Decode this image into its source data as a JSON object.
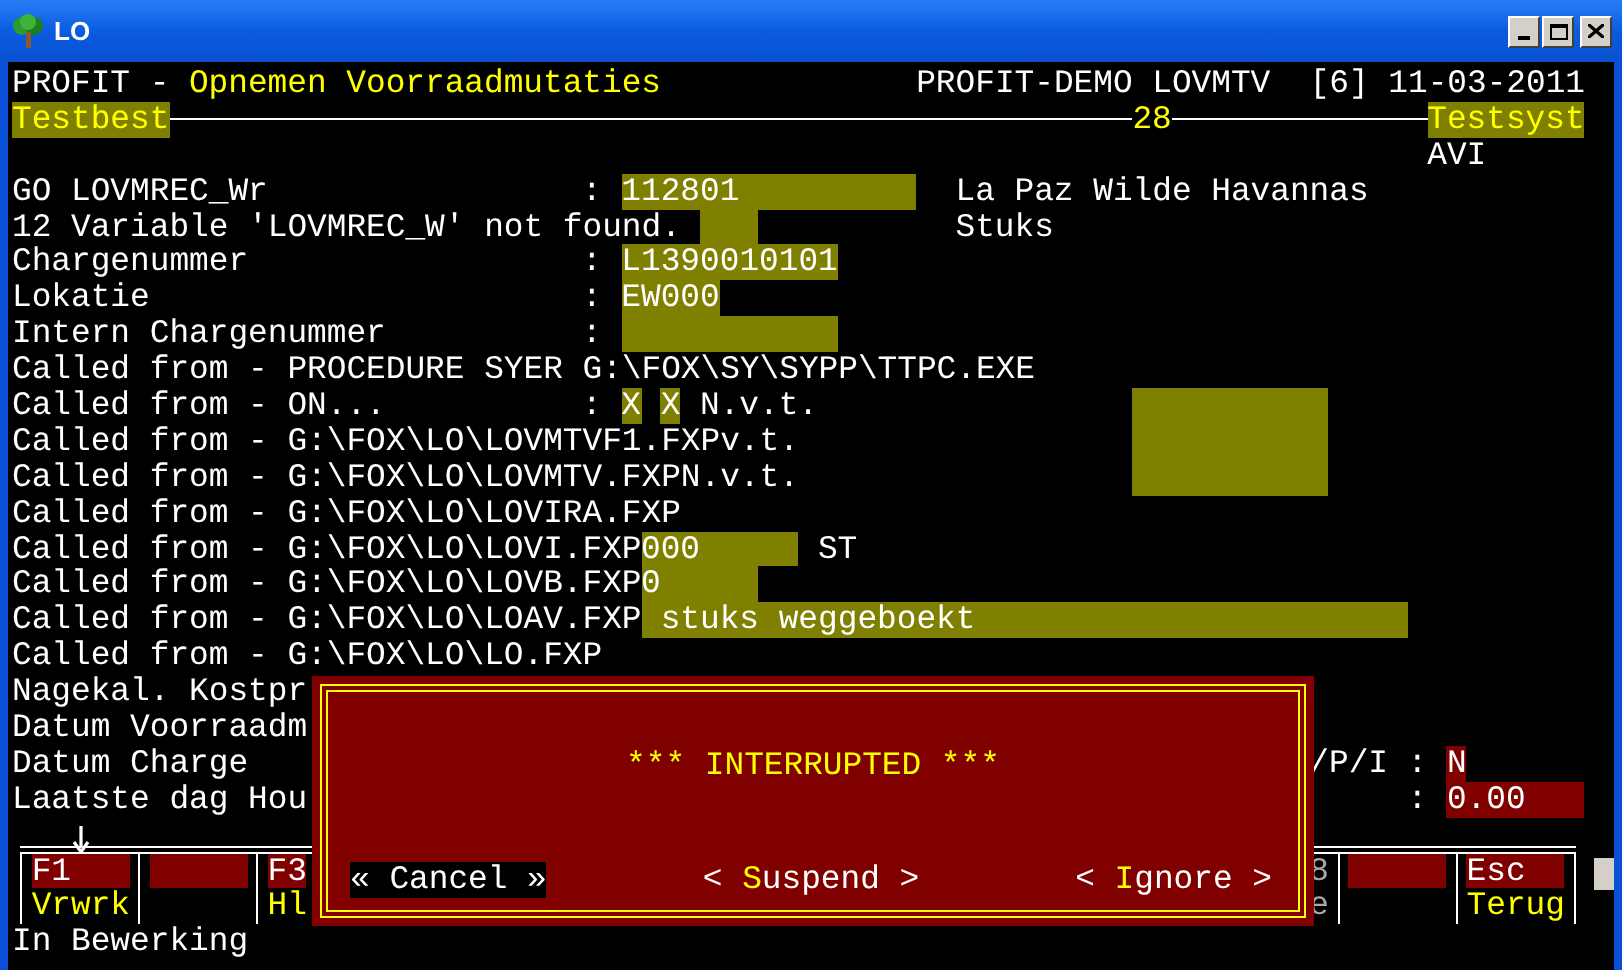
{
  "window": {
    "title": "LO"
  },
  "lines": [
    [
      {
        "kind": "text",
        "text": "PROFIT - "
      },
      {
        "kind": "title",
        "text": "Opnemen Voorraadmutaties"
      },
      {
        "kind": "text",
        "text": "PROFIT-DEMO LOVMTV  [6] 11-03-2011"
      }
    ],
    [
      {
        "kind": "tag",
        "text": "Testbest"
      },
      {
        "kind": "title",
        "text": "28"
      },
      {
        "kind": "tag",
        "text": "Testsyst"
      }
    ],
    [
      {
        "kind": "text",
        "text": "AVI"
      }
    ],
    [
      {
        "kind": "text",
        "text": "GO LOVMREC_Wr"
      },
      {
        "kind": "text",
        "text": ":"
      },
      {
        "kind": "field",
        "text": "112801"
      },
      {
        "kind": "text",
        "text": "La Paz Wilde Havannas"
      }
    ],
    [
      {
        "kind": "text",
        "text": "12 Variable 'LOVMREC_W' not found."
      },
      {
        "kind": "blank_field"
      },
      {
        "kind": "text",
        "text": "Stuks"
      }
    ],
    [
      {
        "kind": "text",
        "text": "Chargenummer"
      },
      {
        "kind": "text",
        "text": ":"
      },
      {
        "kind": "field",
        "text": "L1390010101"
      }
    ],
    [
      {
        "kind": "text",
        "text": "Lokatie"
      },
      {
        "kind": "text",
        "text": ":"
      },
      {
        "kind": "field",
        "text": "EW000"
      }
    ],
    [
      {
        "kind": "text",
        "text": "Intern Chargenummer"
      },
      {
        "kind": "text",
        "text": ":"
      },
      {
        "kind": "blank_field"
      }
    ],
    [
      {
        "kind": "text",
        "text": "Called from - PROCEDURE SYER G:\\FOX\\SY\\SYPP\\TTPC.EXE"
      }
    ],
    [
      {
        "kind": "text",
        "text": "Called from - ON..."
      },
      {
        "kind": "text",
        "text": ":"
      },
      {
        "kind": "field",
        "text": "X"
      },
      {
        "kind": "field",
        "text": "X"
      },
      {
        "kind": "text",
        "text": "N.v.t."
      },
      {
        "kind": "blank_field"
      }
    ],
    [
      {
        "kind": "text",
        "text": "Called from - G:\\FOX\\LO\\LOVMTVF1.FXPv.t."
      }
    ],
    [
      {
        "kind": "text",
        "text": "Called from - G:\\FOX\\LO\\LOVMTV.FXPN.v.t."
      }
    ],
    [
      {
        "kind": "text",
        "text": "Called from - G:\\FOX\\LO\\LOVIRA.FXP"
      }
    ],
    [
      {
        "kind": "text",
        "text": "Called from - G:\\FOX\\LO\\LOVI.FXP"
      },
      {
        "kind": "field",
        "text": "000"
      },
      {
        "kind": "text",
        "text": "ST"
      }
    ],
    [
      {
        "kind": "text",
        "text": "Called from - G:\\FOX\\LO\\LOVB.FXP"
      },
      {
        "kind": "field",
        "text": "0"
      }
    ],
    [
      {
        "kind": "text",
        "text": "Called from - G:\\FOX\\LO\\LOAV.FXP"
      },
      {
        "kind": "field",
        "text": "stuks weggeboekt"
      }
    ],
    [
      {
        "kind": "text",
        "text": "Called from - G:\\FOX\\LO\\LO.FXP"
      }
    ],
    [
      {
        "kind": "text",
        "text": "Nagekal. Kostpr"
      }
    ],
    [
      {
        "kind": "text",
        "text": "Datum Voorraadm"
      }
    ],
    [
      {
        "kind": "text",
        "text": "Datum Charge"
      },
      {
        "kind": "text",
        "text": "/P/I"
      },
      {
        "kind": "text",
        "text": ":"
      },
      {
        "kind": "entry",
        "text": "N"
      }
    ],
    [
      {
        "kind": "text",
        "text": "Laatste dag Hou"
      },
      {
        "kind": "text",
        "text": ":"
      },
      {
        "kind": "entry",
        "text": "0.00"
      }
    ]
  ],
  "function_keys": [
    [
      {
        "kind": "fkey",
        "text": "F1"
      },
      {
        "kind": "fkey_blank"
      },
      {
        "kind": "fkey",
        "text": "F3"
      },
      {
        "kind": "muted",
        "text": "8"
      },
      {
        "kind": "fkey_blank"
      },
      {
        "kind": "fkey",
        "text": "Esc"
      }
    ],
    [
      {
        "kind": "fkey_label",
        "text": "Vrwrk"
      },
      {
        "kind": "fkey_label",
        "text": "Hl"
      },
      {
        "kind": "muted",
        "text": "e"
      },
      {
        "kind": "fkey_label",
        "text": "Terug"
      }
    ],
    [
      {
        "kind": "text",
        "text": "In Bewerking"
      }
    ]
  ],
  "dialog": {
    "message": "*** INTERRUPTED ***",
    "buttons": [
      {
        "before": "« ",
        "hotkey": "C",
        "after": "ancel »",
        "selected": true
      },
      {
        "before": "< ",
        "hotkey": "S",
        "after": "uspend >",
        "selected": false
      },
      {
        "before": "< ",
        "hotkey": "I",
        "after": "gnore >",
        "selected": false
      }
    ]
  }
}
